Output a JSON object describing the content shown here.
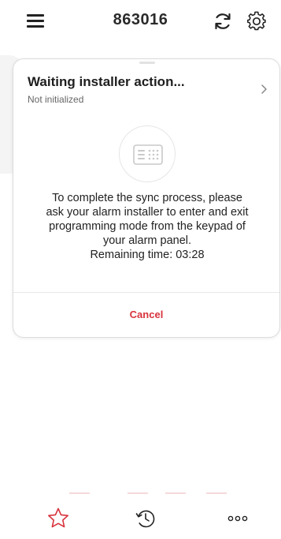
{
  "header": {
    "title": "863016",
    "menu_icon": "hamburger-menu-icon",
    "sync_icon": "sync-icon",
    "settings_icon": "gear-icon"
  },
  "status_card": {
    "title": "Waiting installer action...",
    "subtitle": "Not initialized",
    "illustration_icon": "keypad-icon",
    "message_lines": [
      "To complete the sync process, please",
      "ask your alarm installer to enter and exit",
      "programming mode from the keypad of",
      "your alarm panel.",
      "Remaining time: 03:28"
    ],
    "cancel_label": "Cancel"
  },
  "bottom_nav": {
    "items": [
      {
        "icon": "star-icon",
        "active": true
      },
      {
        "icon": "history-icon",
        "active": false
      },
      {
        "icon": "more-icon",
        "active": false
      }
    ]
  },
  "colors": {
    "accent": "#d8333c",
    "text": "#222222",
    "muted": "#666666"
  }
}
